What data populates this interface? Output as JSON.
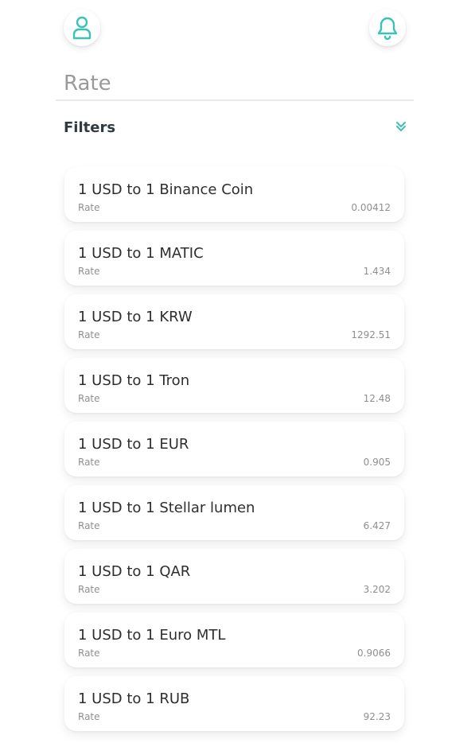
{
  "header": {
    "profile_icon": "user-icon",
    "notifications_icon": "bell-icon"
  },
  "search": {
    "placeholder": "Rate",
    "value": ""
  },
  "filters": {
    "label": "Filters",
    "toggle_icon": "double-chevron-down-icon"
  },
  "colors": {
    "accent": "#3cc2b4",
    "divider": "#e9ebeb",
    "title_text": "#2e2e2e",
    "muted_text": "#8f8f8f"
  },
  "rates": [
    {
      "title": "1 USD to 1 Binance Coin",
      "label": "Rate",
      "value": "0.00412"
    },
    {
      "title": "1 USD to 1 MATIC",
      "label": "Rate",
      "value": "1.434"
    },
    {
      "title": "1 USD to 1 KRW",
      "label": "Rate",
      "value": "1292.51"
    },
    {
      "title": "1 USD to 1 Tron",
      "label": "Rate",
      "value": "12.48"
    },
    {
      "title": "1 USD to 1 EUR",
      "label": "Rate",
      "value": "0.905"
    },
    {
      "title": "1 USD to 1 Stellar lumen",
      "label": "Rate",
      "value": "6.427"
    },
    {
      "title": "1 USD to 1 QAR",
      "label": "Rate",
      "value": "3.202"
    },
    {
      "title": "1 USD to 1 Euro MTL",
      "label": "Rate",
      "value": "0.9066"
    },
    {
      "title": "1 USD to 1 RUB",
      "label": "Rate",
      "value": "92.23"
    }
  ]
}
